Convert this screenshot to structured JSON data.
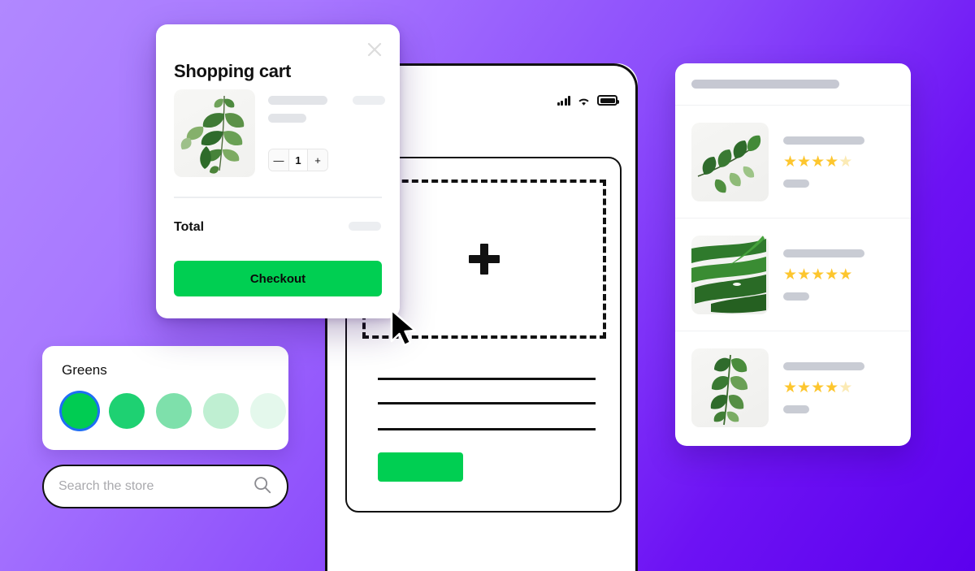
{
  "background": {
    "gradient_from": "#b188ff",
    "gradient_to": "#5c00ee"
  },
  "cart": {
    "title": "Shopping cart",
    "close_icon": "close-icon",
    "thumbnail_alt": "eucalyptus-branch",
    "quantity": {
      "decrement_label": "—",
      "value": "1",
      "increment_label": "+"
    },
    "total_label": "Total",
    "checkout_label": "Checkout",
    "checkout_color": "#00cf52"
  },
  "greens": {
    "title": "Greens",
    "selected_index": 0,
    "selection_ring_color": "#1f6df5",
    "swatches": [
      {
        "name": "green-500",
        "color": "#00cc52"
      },
      {
        "name": "green-400",
        "color": "#1ed172"
      },
      {
        "name": "green-300",
        "color": "#7ee0ab"
      },
      {
        "name": "green-200",
        "color": "#bfefd2"
      },
      {
        "name": "green-100",
        "color": "#e4f8ec"
      }
    ]
  },
  "search": {
    "placeholder": "Search the store",
    "value": "",
    "icon": "search-icon"
  },
  "phone": {
    "statusbar": {
      "signal_icon": "signal-bars-icon",
      "wifi_icon": "wifi-icon",
      "battery_icon": "battery-icon"
    },
    "dropzone": {
      "icon": "plus-icon"
    },
    "cta_color": "#00cf52",
    "text_lines": 3
  },
  "cursor": {
    "icon": "mouse-pointer-icon"
  },
  "product_list": {
    "header_skeleton": true,
    "items": [
      {
        "thumbnail_alt": "ficus-branch",
        "rating": 4,
        "rating_max": 5,
        "title_skeleton": true,
        "price_skeleton": true
      },
      {
        "thumbnail_alt": "monstera-leaf",
        "rating": 5,
        "rating_max": 5,
        "title_skeleton": true,
        "price_skeleton": true
      },
      {
        "thumbnail_alt": "jade-plant",
        "rating": 4,
        "rating_max": 5,
        "title_skeleton": true,
        "price_skeleton": true
      }
    ],
    "star_full_color": "#fdc62e",
    "star_empty_color": "#fbeab4"
  }
}
